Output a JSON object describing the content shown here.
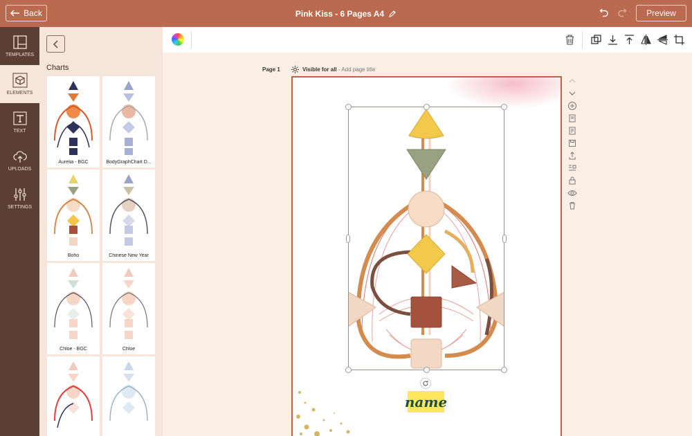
{
  "topbar": {
    "back_label": "Back",
    "document_title": "Pink Kiss - 6 Pages A4",
    "preview_label": "Preview"
  },
  "rail": [
    {
      "label": "TEMPLATES",
      "icon": "templates-icon"
    },
    {
      "label": "ELEMENTS",
      "icon": "cube-icon",
      "active": true
    },
    {
      "label": "TEXT",
      "icon": "text-icon"
    },
    {
      "label": "UPLOADS",
      "icon": "cloud-upload-icon"
    },
    {
      "label": "SETTINGS",
      "icon": "sliders-icon"
    }
  ],
  "panel": {
    "title": "Charts",
    "cards": [
      {
        "label": "Aurelia - BGC"
      },
      {
        "label": "BodyGraphChart D..."
      },
      {
        "label": "Boho"
      },
      {
        "label": "Chinese New Year"
      },
      {
        "label": "Chloe - BGC"
      },
      {
        "label": "Chloe"
      },
      {
        "label": ""
      },
      {
        "label": ""
      }
    ]
  },
  "page": {
    "label": "Page 1",
    "visibility": "Visible for all",
    "title_placeholder": "- Add page title",
    "name_text": "name"
  },
  "colors": {
    "accent": "#b96a4f",
    "rail": "#5b3e34",
    "panel": "#f6e5da",
    "workspace": "#fbeee4",
    "page_border": "#c06244"
  }
}
